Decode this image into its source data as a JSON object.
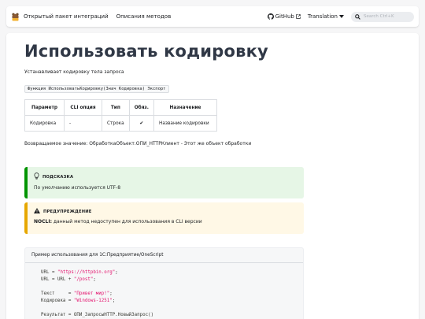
{
  "navbar": {
    "logo_icon": "bear-logo-icon",
    "links": [
      "Открытый пакет интеграций",
      "Описания методов"
    ],
    "github_label": "GitHub",
    "translation_label": "Translation",
    "search_placeholder": "Search Ctrl+K"
  },
  "page": {
    "title": "Использовать кодировку",
    "description": "Устанавливает кодировку тела запроса",
    "signature": "Функция ИспользоватьКодировку(Знач Кодировка) Экспорт",
    "params_headers": [
      "Параметр",
      "CLI опция",
      "Тип",
      "Обяз.",
      "Назначение"
    ],
    "params_rows": [
      [
        "Кодировка",
        "-",
        "Строка",
        "✔",
        "Название кодировки"
      ]
    ],
    "return_text": "Возвращаемое значение: ОбработкаОбъект.ОПИ_HTTPКлиент - Этот же объект обработки"
  },
  "tip": {
    "heading": "ПОДСКАЗКА",
    "text": "По умолчанию используется UTF-8",
    "color": "#009400"
  },
  "warning": {
    "heading": "ПРЕДУПРЕЖДЕНИЕ",
    "bold_text": "NOCLI:",
    "text": " данный метод недоступен для использования в CLI версии",
    "color": "#e6a700"
  },
  "code_example": {
    "title": "Пример использования для 1С:Предприятие/OneScript",
    "lines": [
      {
        "plain": "URL = ",
        "str": "\"https://httpbin.org\"",
        "tail": ";"
      },
      {
        "plain": "URL = URL + ",
        "str": "\"/post\"",
        "tail": ";"
      },
      {
        "plain": "",
        "str": "",
        "tail": ""
      },
      {
        "plain": "Текст     = ",
        "str": "\"Привет мир!\"",
        "tail": ";"
      },
      {
        "plain": "Кодировка = ",
        "str": "\"Windows-1251\"",
        "tail": ";"
      },
      {
        "plain": "",
        "str": "",
        "tail": ""
      },
      {
        "plain": "Результат = ОПИ_ЗапросыHTTP.НовыйЗапрос()",
        "str": "",
        "tail": ""
      }
    ]
  }
}
